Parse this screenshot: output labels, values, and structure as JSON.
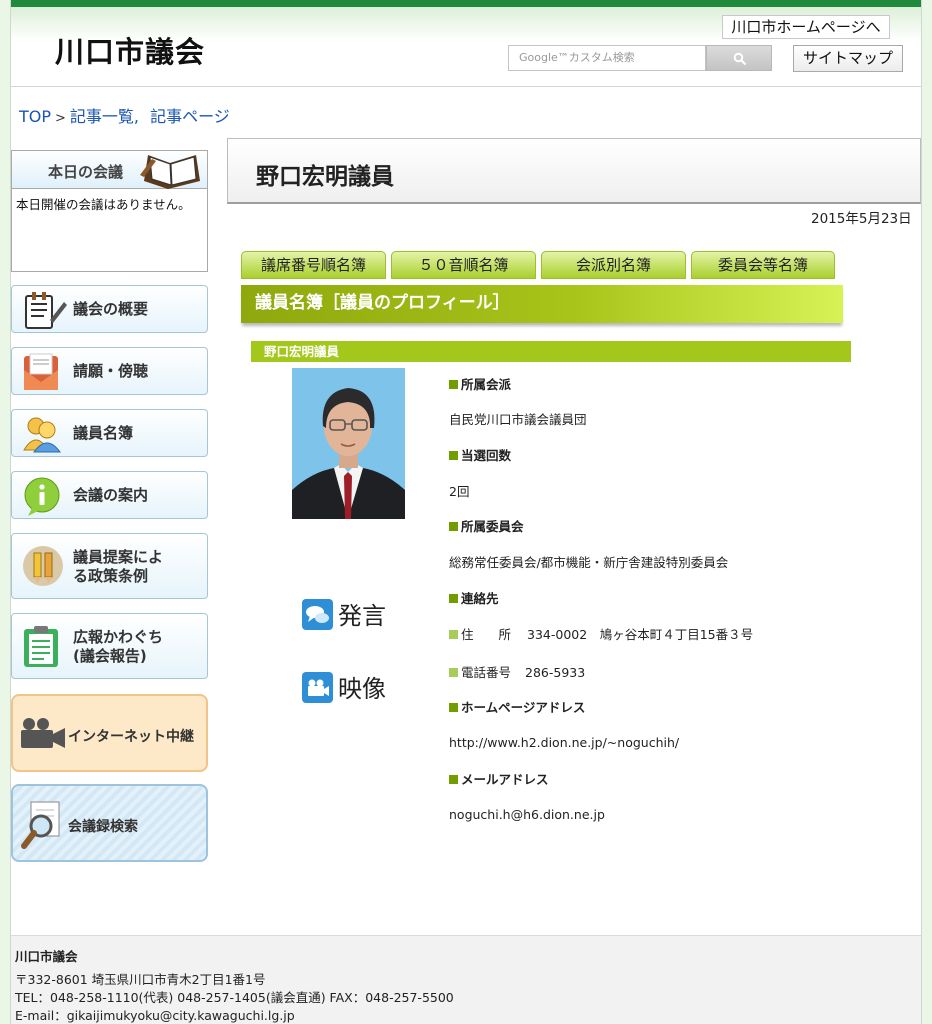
{
  "header": {
    "site_title": "川口市議会",
    "home_link": "川口市ホームページへ",
    "search_placeholder": "Google™カスタム検索",
    "sitemap": "サイトマップ"
  },
  "breadcrumb": {
    "top": "TOP",
    "sep": ">",
    "list": "記事一覧,",
    "page": "記事ページ"
  },
  "sidebar": {
    "today_title": "本日の会議",
    "today_text": "本日開催の会議はありません。",
    "items": [
      {
        "label": "議会の概要",
        "icon": "notepad-icon"
      },
      {
        "label": "請願・傍聴",
        "icon": "envelope-icon"
      },
      {
        "label": "議員名簿",
        "icon": "people-icon"
      },
      {
        "label": "会議の案内",
        "icon": "info-icon"
      },
      {
        "label": "議員提案によ\nる政策条例",
        "icon": "pencils-icon"
      },
      {
        "label": "広報かわぐち\n(議会報告)",
        "icon": "clipboard-icon"
      }
    ],
    "internet_broadcast": "インターネット中継",
    "minutes_search": "会議録検索"
  },
  "main": {
    "page_title": "野口宏明議員",
    "date": "2015年5月23日",
    "tabs": [
      "議席番号順名簿",
      "５０音順名簿",
      "会派別名簿",
      "委員会等名簿"
    ],
    "section_title": "議員名簿［議員のプロフィール］",
    "member_name": "野口宏明議員",
    "links": {
      "speech": "発言",
      "video": "映像"
    },
    "profile": {
      "faction_label": "所属会派",
      "faction": "自民党川口市議会議員団",
      "elected_label": "当選回数",
      "elected": "2回",
      "committee_label": "所属委員会",
      "committee": "総務常任委員会/都市機能・新庁舎建設特別委員会",
      "contact_label": "連絡先",
      "address_label": "住　　所",
      "address": "334-0002　鳩ヶ谷本町４丁目15番３号",
      "phone_label": "電話番号",
      "phone": "286-5933",
      "homepage_label": "ホームページアドレス",
      "homepage": "http://www.h2.dion.ne.jp/~noguchih/",
      "mail_label": "メールアドレス",
      "mail": "noguchi.h@h6.dion.ne.jp"
    }
  },
  "footer": {
    "name": "川口市議会",
    "address": "〒332-8601 埼玉県川口市青木2丁目1番1号",
    "tel": "TEL：048-258-1110(代表) 048-257-1405(議会直通) FAX：048-257-5500",
    "email": "E-mail：gikaijimukyoku@city.kawaguchi.lg.jp"
  },
  "colors": {
    "header_green": "#1f8a3c",
    "tab_green": "#aacf2e",
    "section_green": "#8fa80e",
    "link_blue": "#1a55b5"
  }
}
